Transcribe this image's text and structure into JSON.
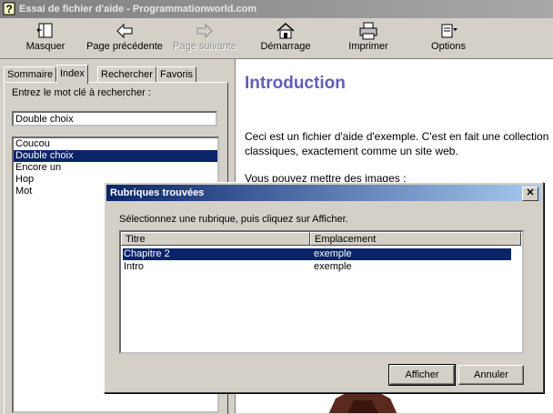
{
  "window": {
    "title": "Essai de fichier d'aide - Programmationworld.com",
    "icon": "help-question-icon"
  },
  "toolbar": {
    "items": [
      {
        "label": "Masquer",
        "icon": "hide-pane-icon",
        "enabled": true
      },
      {
        "label": "Page précédente",
        "icon": "back-arrow-icon",
        "enabled": true
      },
      {
        "label": "Page suivante",
        "icon": "forward-arrow-icon",
        "enabled": false
      },
      {
        "label": "Démarrage",
        "icon": "home-icon",
        "enabled": true
      },
      {
        "label": "Imprimer",
        "icon": "printer-icon",
        "enabled": true
      },
      {
        "label": "Options",
        "icon": "options-icon",
        "enabled": true
      }
    ]
  },
  "navigation": {
    "tabs": [
      "Sommaire",
      "Index",
      "Rechercher",
      "Favoris"
    ],
    "active_tab": "Index",
    "keyword_label": "Entrez le mot clé à rechercher :",
    "keyword_value": "Double choix",
    "keywords": [
      "Coucou",
      "Double choix",
      "Encore un",
      "Hop",
      "Mot"
    ],
    "selected_keyword": "Double choix"
  },
  "content": {
    "heading": "Introduction",
    "paragraph1_line1": "Ceci est un fichier d'aide d'exemple. C'est en fait une collection",
    "paragraph1_line2": "classiques, exactement comme un site web.",
    "paragraph2": "Vous pouvez mettre des images :"
  },
  "dialog": {
    "title": "Rubriques trouvées",
    "prompt": "Sélectionnez une rubrique, puis cliquez sur Afficher.",
    "columns": [
      "Titre",
      "Emplacement"
    ],
    "rows": [
      {
        "title": "Chapitre 2",
        "location": "exemple",
        "selected": true
      },
      {
        "title": "Intro",
        "location": "exemple",
        "selected": false
      }
    ],
    "ok_label": "Afficher",
    "cancel_label": "Annuler",
    "close_glyph": "✕"
  },
  "colors": {
    "selection": "#0a246a",
    "heading": "#5f5fb8",
    "dialog_title_start": "#0a246a",
    "dialog_title_end": "#a6caf0"
  }
}
